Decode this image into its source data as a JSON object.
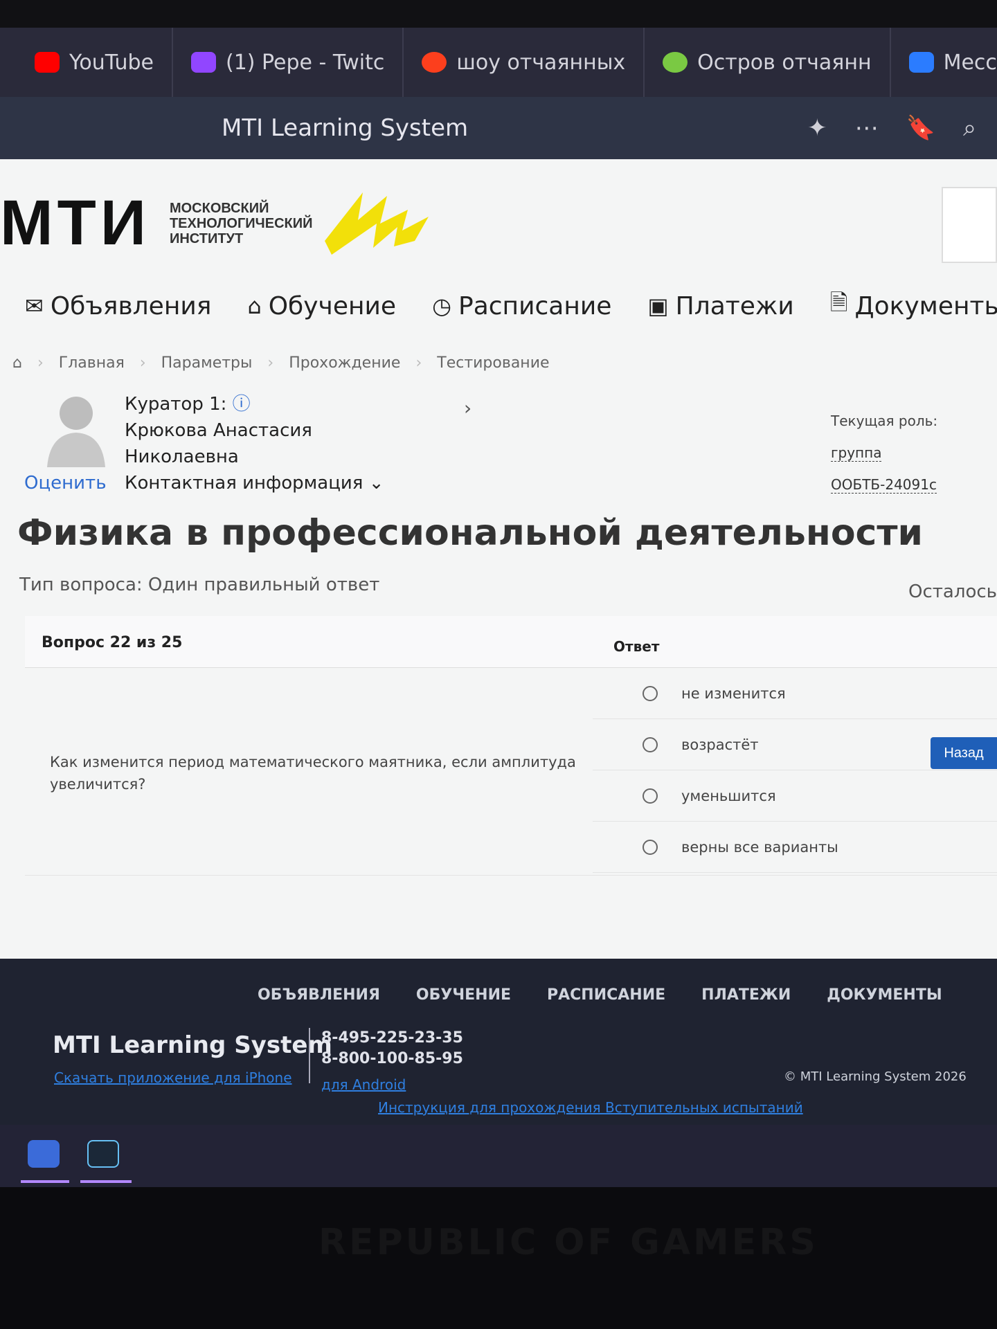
{
  "browser": {
    "tabs": [
      {
        "label": "YouTube",
        "icon": "youtube-icon"
      },
      {
        "label": "(1) Pepe - Twitc",
        "icon": "twitch-icon"
      },
      {
        "label": "шоу отчаянных",
        "icon": "yandex-icon"
      },
      {
        "label": "Остров отчаянн",
        "icon": "ostrov-icon"
      },
      {
        "label": "Мессен",
        "icon": "messenger-icon"
      }
    ],
    "window_title": "MTI Learning System",
    "tools": [
      "⋯"
    ]
  },
  "logo": {
    "mti": "МТИ",
    "line1": "Московский",
    "line2": "технологический",
    "line3": "институт",
    "accent_color": "#f2e00a"
  },
  "nav": [
    {
      "label": "Объявления",
      "icon": "megaphone-icon",
      "glyph": "📢"
    },
    {
      "label": "Обучение",
      "icon": "graduation-cap-icon",
      "glyph": "🎓"
    },
    {
      "label": "Расписание",
      "icon": "clock-icon",
      "glyph": "◷"
    },
    {
      "label": "Платежи",
      "icon": "card-icon",
      "glyph": "▣"
    },
    {
      "label": "Документы",
      "icon": "document-icon",
      "glyph": "🗎"
    }
  ],
  "breadcrumbs": [
    "Главная",
    "Параметры",
    "Прохождение",
    "Тестирование"
  ],
  "curator": {
    "label": "Куратор 1:",
    "name1": "Крюкова Анастасия",
    "name2": "Николаевна",
    "contact": "Контактная информация ⌄",
    "rate": "Оценить"
  },
  "role": {
    "label": "Текущая роль:",
    "group": "группа ООБТБ-24091с"
  },
  "course_title": "Физика в профессиональной деятельности",
  "question_type": "Тип вопроса: Один правильный ответ",
  "time_left_label": "Осталось",
  "table": {
    "question_header": "Вопрос 22 из 25",
    "answer_header": "Ответ",
    "question_text": "Как изменится период математического маятника, если амплитуда увеличится?",
    "answers": [
      "не изменится",
      "возрастёт",
      "уменьшится",
      "верны все варианты"
    ]
  },
  "back_button": "Назад",
  "footer": {
    "nav": [
      "ОБЪЯВЛЕНИЯ",
      "ОБУЧЕНИЕ",
      "РАСПИСАНИЕ",
      "ПЛАТЕЖИ",
      "ДОКУМЕНТЫ"
    ],
    "brand": "MTI Learning System",
    "ios_link": "Скачать приложение для iPhone",
    "phone1": "8-495-225-23-35",
    "phone2": "8-800-100-85-95",
    "android_link": "для Android",
    "copyright": "© MTI Learning System 2026",
    "instructions_link": "Инструкция для прохождения Вступительных испытаний"
  },
  "laptop_brand": "REPUBLIC OF GAMERS"
}
